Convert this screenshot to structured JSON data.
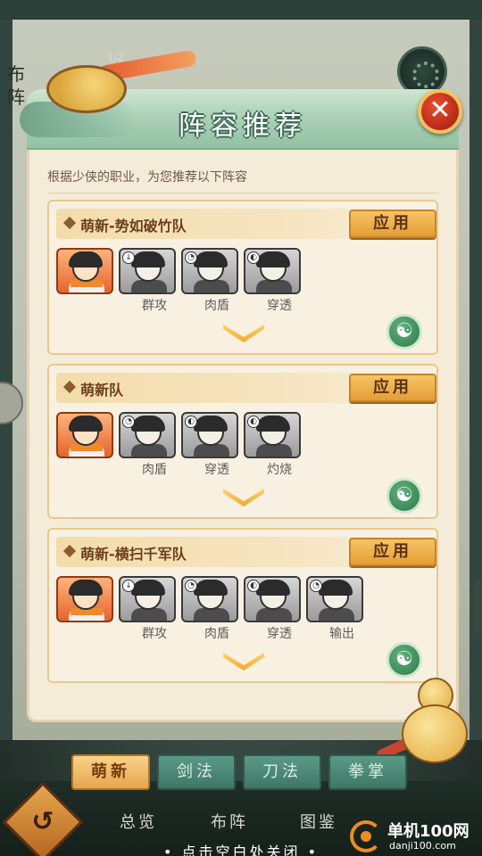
{
  "background": {
    "pager": "1/2",
    "side_text": "布阵"
  },
  "modal": {
    "title": "阵容推荐",
    "subtitle": "根据少侠的职业，为您推荐以下阵容",
    "close_icon": "close-x-icon",
    "cards": [
      {
        "name": "萌新-势如破竹队",
        "apply_label": "应用",
        "heroes": [
          {
            "role": "",
            "badge": "",
            "style": "main"
          },
          {
            "role": "群攻",
            "badge": "↓",
            "style": "gray"
          },
          {
            "role": "肉盾",
            "badge": "◔",
            "style": "gray"
          },
          {
            "role": "穿透",
            "badge": "◐",
            "style": "gray"
          }
        ]
      },
      {
        "name": "萌新队",
        "apply_label": "应用",
        "heroes": [
          {
            "role": "",
            "badge": "",
            "style": "main"
          },
          {
            "role": "肉盾",
            "badge": "◔",
            "style": "gray"
          },
          {
            "role": "穿透",
            "badge": "◐",
            "style": "gray"
          },
          {
            "role": "灼烧",
            "badge": "◐",
            "style": "gray"
          }
        ]
      },
      {
        "name": "萌新-横扫千军队",
        "apply_label": "应用",
        "heroes": [
          {
            "role": "",
            "badge": "",
            "style": "main"
          },
          {
            "role": "群攻",
            "badge": "↓",
            "style": "gray"
          },
          {
            "role": "肉盾",
            "badge": "◔",
            "style": "gray"
          },
          {
            "role": "穿透",
            "badge": "◐",
            "style": "gray"
          },
          {
            "role": "输出",
            "badge": "◔",
            "style": "gray"
          }
        ]
      }
    ]
  },
  "tabs": [
    {
      "label": "萌新",
      "active": true
    },
    {
      "label": "剑法",
      "active": false
    },
    {
      "label": "刀法",
      "active": false
    },
    {
      "label": "拳掌",
      "active": false
    }
  ],
  "bottom_nav": {
    "back_icon": "undo-arrow-icon",
    "items": [
      "总览",
      "布阵",
      "图鉴"
    ],
    "close_hint": "• 点击空白处关闭 •"
  },
  "watermark": {
    "title": "单机100网",
    "url": "danji100.com"
  },
  "colors": {
    "accent": "#e39e35",
    "header_green": "#a9d0b6",
    "close_red": "#b8281a"
  }
}
